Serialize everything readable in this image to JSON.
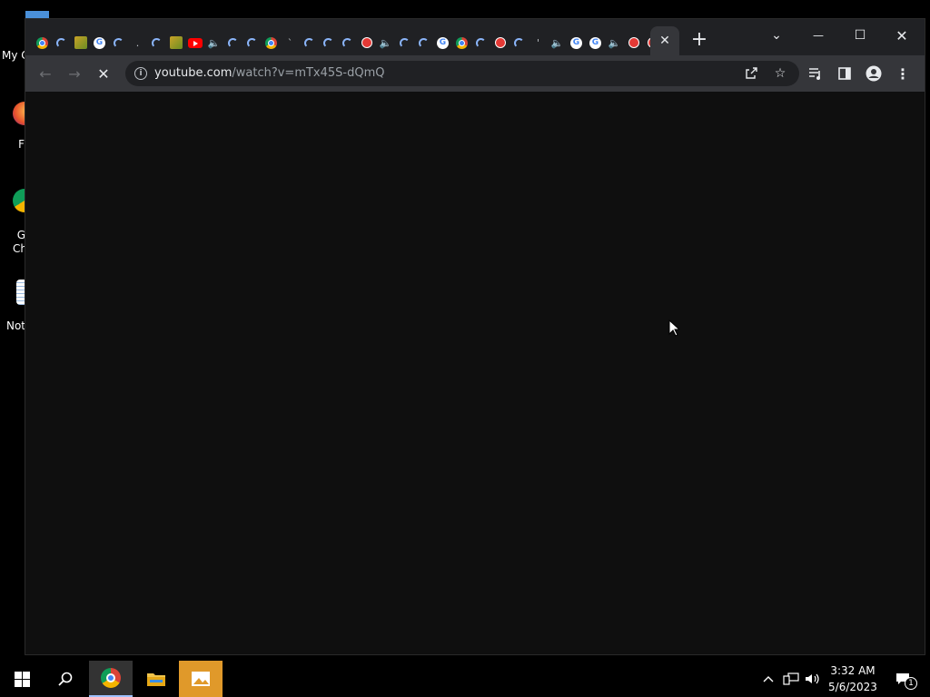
{
  "desktop": {
    "icons": [
      {
        "label": "My C",
        "name": "desktop-icon-my-computer"
      },
      {
        "label": "F",
        "name": "desktop-icon-firefox"
      },
      {
        "label": "G",
        "label2": "Ch",
        "name": "desktop-icon-google-chrome"
      },
      {
        "label": "Not",
        "name": "desktop-icon-notepad"
      }
    ]
  },
  "browser": {
    "active_tab_close": "✕",
    "new_tab": "+",
    "window_controls": {
      "tab_search": "⌄",
      "minimize": "—",
      "maximize": "☐",
      "close": "✕"
    },
    "toolbar": {
      "back": "←",
      "forward": "→",
      "stop": "✕",
      "menu": "⋮"
    },
    "address": {
      "host": "youtube.com",
      "path": "/watch?v=mTx45S-dQmQ"
    }
  },
  "taskbar": {
    "time": "3:32 AM",
    "date": "5/6/2023",
    "notification_count": "1",
    "tray_chevron": "^"
  },
  "colors": {
    "tabstrip": "#202124",
    "toolbar": "#35363a",
    "content": "#0f0f0f",
    "taskbar": "#000000",
    "photos_accent": "#e0992a"
  }
}
